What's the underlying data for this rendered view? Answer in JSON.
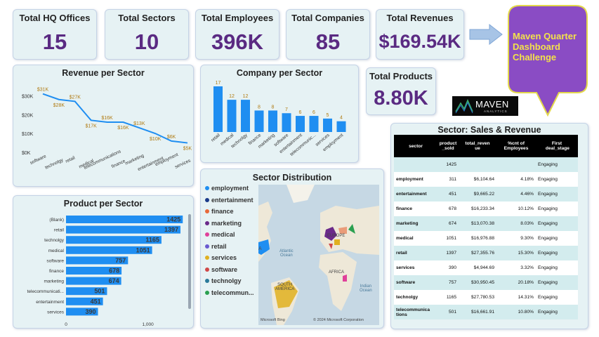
{
  "kpis": {
    "hq_offices": {
      "label": "Total HQ Offices",
      "value": "15"
    },
    "sectors": {
      "label": "Total Sectors",
      "value": "10"
    },
    "employees": {
      "label": "Total Employees",
      "value": "396K"
    },
    "companies": {
      "label": "Total Companies",
      "value": "85"
    },
    "revenues": {
      "label": "Total Revenues",
      "value": "$169.54K"
    },
    "products": {
      "label": "Total Products",
      "value": "8.80K"
    }
  },
  "banner": {
    "text": "Maven Quarter Dashboard Challenge"
  },
  "logo": {
    "text": "MAVEN",
    "sub": "ANALYTICS"
  },
  "revenue_chart": {
    "title": "Revenue per Sector",
    "chart_data": {
      "type": "line",
      "categories": [
        "software",
        "technolgy",
        "retail",
        "medical",
        "telecommunications",
        "finance",
        "marketing",
        "entertainment",
        "employment",
        "services"
      ],
      "values": [
        31,
        28,
        27,
        17,
        16,
        16,
        13,
        10,
        6,
        5
      ],
      "data_labels": [
        "$31K",
        "$28K",
        "$27K",
        "$17K",
        "$16K",
        "$16K",
        "$13K",
        "$10K",
        "$6K",
        "$5K"
      ],
      "y_ticks": [
        "$0K",
        "$10K",
        "$20K",
        "$30K"
      ],
      "ylim": [
        0,
        32
      ],
      "color": "#1f8ef1"
    }
  },
  "company_chart": {
    "title": "Company per Sector",
    "chart_data": {
      "type": "bar",
      "categories": [
        "retail",
        "medical",
        "technolgy",
        "finance",
        "marketing",
        "software",
        "entertainment",
        "telecommunic...",
        "services",
        "employment"
      ],
      "values": [
        17,
        12,
        12,
        8,
        8,
        7,
        6,
        6,
        5,
        4
      ],
      "color": "#1f8ef1"
    }
  },
  "product_chart": {
    "title": "Product per Sector",
    "chart_data": {
      "type": "bar",
      "orientation": "horizontal",
      "categories": [
        "(Blank)",
        "retail",
        "technolgy",
        "medical",
        "software",
        "finance",
        "marketing",
        "telecommunicati...",
        "entertainment",
        "services"
      ],
      "values": [
        1425,
        1397,
        1165,
        1051,
        757,
        678,
        674,
        501,
        451,
        390
      ],
      "x_ticks": [
        "0",
        "1,000"
      ],
      "xlim": [
        0,
        1500
      ],
      "color": "#1f8ef1"
    }
  },
  "distribution": {
    "title": "Sector Distribution",
    "legend": [
      {
        "label": "employment",
        "color": "#1f8ef1"
      },
      {
        "label": "entertainment",
        "color": "#1a3a8a"
      },
      {
        "label": "finance",
        "color": "#e8693b"
      },
      {
        "label": "marketing",
        "color": "#6b2a8a"
      },
      {
        "label": "medical",
        "color": "#e0409a"
      },
      {
        "label": "retail",
        "color": "#6a5ad0"
      },
      {
        "label": "services",
        "color": "#e0b020"
      },
      {
        "label": "software",
        "color": "#d04848"
      },
      {
        "label": "technolgy",
        "color": "#2a7a9a"
      },
      {
        "label": "telecommun...",
        "color": "#2aa050"
      }
    ],
    "map_labels": {
      "europe": "EUROPE",
      "africa": "AFRICA",
      "south_america": "SOUTH\nAMERICA",
      "atlantic": "Atlantic\nOcean",
      "indian": "Indian\nOcean",
      "na": "A",
      "bing": "Microsoft Bing",
      "copyright": "© 2024 Microsoft Corporation"
    }
  },
  "table": {
    "title": "Sector: Sales & Revenue",
    "headers": [
      "sector",
      "product\n_sold",
      "total_reven\nue",
      "%cnt of\nEmployees",
      "First\n deal_stage"
    ],
    "rows": [
      [
        "",
        "1425",
        "",
        "",
        "Engaging"
      ],
      [
        "employment",
        "311",
        "$6,104.64",
        "4.18%",
        "Engaging"
      ],
      [
        "entertainment",
        "451",
        "$9,665.22",
        "4.46%",
        "Engaging"
      ],
      [
        "finance",
        "678",
        "$16,233.34",
        "10.12%",
        "Engaging"
      ],
      [
        "marketing",
        "674",
        "$13,070.38",
        "8.03%",
        "Engaging"
      ],
      [
        "medical",
        "1051",
        "$16,976.88",
        "9.30%",
        "Engaging"
      ],
      [
        "retail",
        "1397",
        "$27,355.76",
        "15.30%",
        "Engaging"
      ],
      [
        "services",
        "390",
        "$4,944.69",
        "3.32%",
        "Engaging"
      ],
      [
        "software",
        "757",
        "$30,950.45",
        "20.18%",
        "Engaging"
      ],
      [
        "technolgy",
        "1165",
        "$27,780.53",
        "14.31%",
        "Engaging"
      ],
      [
        "telecommunica\ntions",
        "501",
        "$16,661.91",
        "10.80%",
        "Engaging"
      ]
    ]
  }
}
